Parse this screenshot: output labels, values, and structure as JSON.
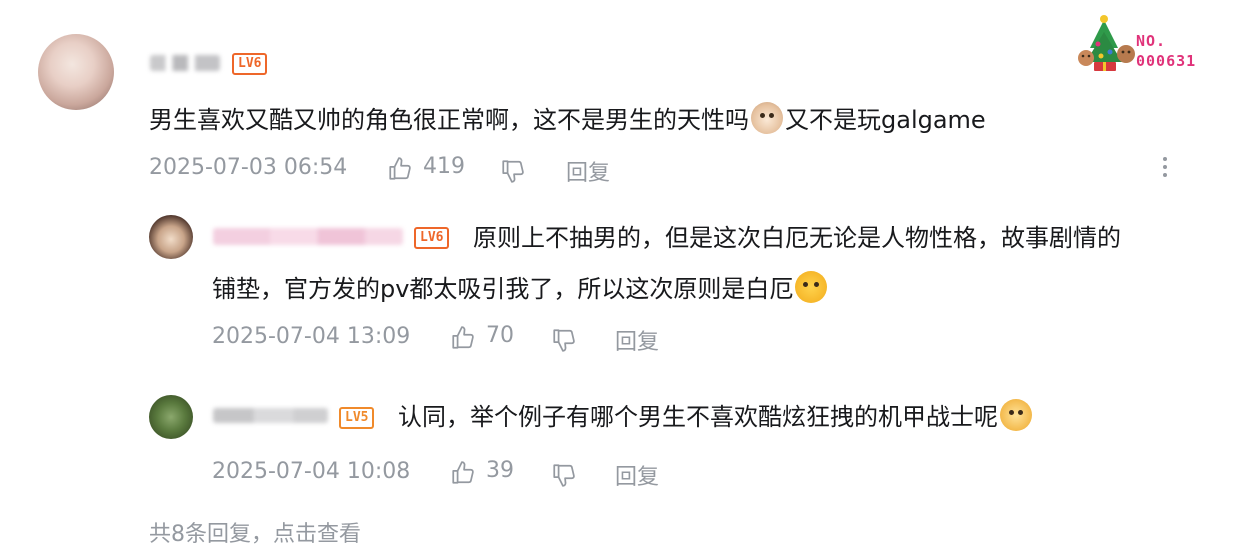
{
  "fan_badge": {
    "line1": "NO.",
    "line2": "000631",
    "icon": "christmas-tree-bear-badge-icon"
  },
  "comment": {
    "level": "LV6",
    "text": "男生喜欢又酷又帅的角色很正常啊，这不是男生的天性吗",
    "text_after_emoji": "又不是玩galgame",
    "emoji": "dog-smile-emoji",
    "time": "2025-07-03 06:54",
    "likes": "419",
    "reply_label": "回复",
    "more_icon": "more-vertical-icon"
  },
  "replies": [
    {
      "level": "LV6",
      "text_line1": "原则上不抽男的，但是这次白厄无论是人物性格，故事剧情的",
      "text_line2": "铺垫，官方发的pv都太吸引我了，所以这次原则是白厄",
      "emoji": "scream-emoji",
      "time": "2025-07-04 13:09",
      "likes": "70",
      "reply_label": "回复"
    },
    {
      "level": "LV5",
      "text": "认同，举个例子有哪个男生不喜欢酷炫狂拽的机甲战士呢",
      "emoji": "doge-emoji",
      "time": "2025-07-04 10:08",
      "likes": "39",
      "reply_label": "回复"
    }
  ],
  "view_more": "共8条回复，点击查看",
  "colors": {
    "level_badge": "#ee672a",
    "meta_text": "#9499a0",
    "fan_badge_text": "#e0337a"
  }
}
